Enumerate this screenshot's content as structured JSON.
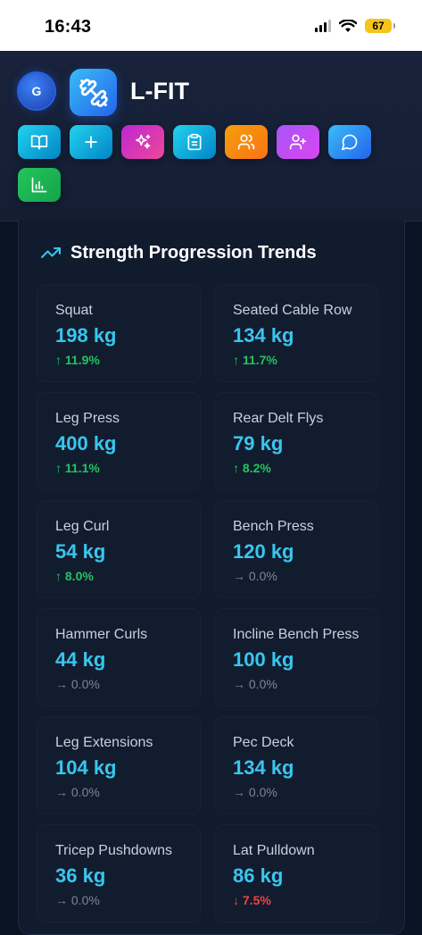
{
  "status_bar": {
    "time": "16:43",
    "battery": "67"
  },
  "header": {
    "avatar_initial": "G",
    "app_title": "L-FIT",
    "toolbar": [
      {
        "name": "library-button",
        "icon": "book-open-icon",
        "color": "#0ea5e9"
      },
      {
        "name": "add-button",
        "icon": "plus-icon",
        "color": "#0ea5e9"
      },
      {
        "name": "ai-button",
        "icon": "sparkles-icon",
        "color": "#d946ef"
      },
      {
        "name": "plan-button",
        "icon": "clipboard-icon",
        "color": "#0ea5e9"
      },
      {
        "name": "community-button",
        "icon": "users-icon",
        "color": "#f59e0b"
      },
      {
        "name": "add-friend-button",
        "icon": "user-plus-icon",
        "color": "#c026d3"
      },
      {
        "name": "chat-button",
        "icon": "message-circle-icon",
        "color": "#0ea5e9"
      },
      {
        "name": "stats-button",
        "icon": "bar-chart-icon",
        "color": "#22c55e"
      }
    ]
  },
  "card": {
    "title": "Strength Progression Trends",
    "exercises": [
      {
        "name": "Squat",
        "weight": "198 kg",
        "change": "↑ 11.9%",
        "trend": "up"
      },
      {
        "name": "Seated Cable Row",
        "weight": "134 kg",
        "change": "↑ 11.7%",
        "trend": "up"
      },
      {
        "name": "Leg Press",
        "weight": "400 kg",
        "change": "↑ 11.1%",
        "trend": "up"
      },
      {
        "name": "Rear Delt Flys",
        "weight": "79 kg",
        "change": "↑ 8.2%",
        "trend": "up"
      },
      {
        "name": "Leg Curl",
        "weight": "54 kg",
        "change": "↑ 8.0%",
        "trend": "up"
      },
      {
        "name": "Bench Press",
        "weight": "120 kg",
        "change": "→ 0.0%",
        "trend": "flat"
      },
      {
        "name": "Hammer Curls",
        "weight": "44 kg",
        "change": "→ 0.0%",
        "trend": "flat"
      },
      {
        "name": "Incline Bench Press",
        "weight": "100 kg",
        "change": "→ 0.0%",
        "trend": "flat"
      },
      {
        "name": "Leg Extensions",
        "weight": "104 kg",
        "change": "→ 0.0%",
        "trend": "flat"
      },
      {
        "name": "Pec Deck",
        "weight": "134 kg",
        "change": "→ 0.0%",
        "trend": "flat"
      },
      {
        "name": "Tricep Pushdowns",
        "weight": "36 kg",
        "change": "→ 0.0%",
        "trend": "flat"
      },
      {
        "name": "Lat Pulldown",
        "weight": "86 kg",
        "change": "↓ 7.5%",
        "trend": "down"
      }
    ]
  },
  "colors": {
    "background": "#0b1424",
    "card": "#111b2e",
    "accent": "#38c6ee",
    "up": "#22c55e",
    "down": "#ef4444",
    "flat": "#7b8699"
  }
}
